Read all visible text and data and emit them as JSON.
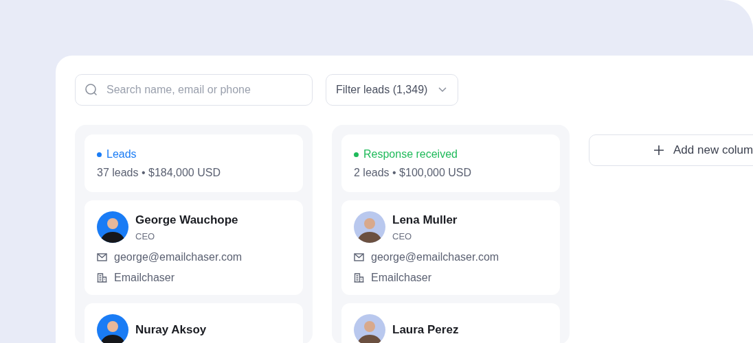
{
  "search": {
    "placeholder": "Search name, email or phone"
  },
  "filter": {
    "label": "Filter leads (1,349)"
  },
  "columns": [
    {
      "title": "Leads",
      "color": "#1a7cf5",
      "summary": "37 leads • $184,000 USD",
      "cards": [
        {
          "name": "George Wauchope",
          "role": "CEO",
          "email": "george@emailchaser.com",
          "company": "Emailchaser"
        },
        {
          "name": "Nuray Aksoy"
        }
      ]
    },
    {
      "title": "Response received",
      "color": "#1fba5a",
      "summary": "2 leads • $100,000 USD",
      "cards": [
        {
          "name": "Lena Muller",
          "role": "CEO",
          "email": "george@emailchaser.com",
          "company": "Emailchaser"
        },
        {
          "name": "Laura Perez"
        }
      ]
    }
  ],
  "add_column": {
    "label": "Add new colum"
  }
}
